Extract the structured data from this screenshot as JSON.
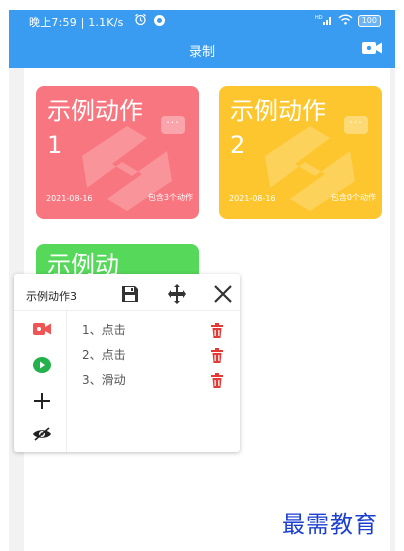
{
  "status_bar": {
    "time": "晚上7:59 | 1.1K/s",
    "battery": "100"
  },
  "header": {
    "title": "录制"
  },
  "cards": [
    {
      "name": "示例动作1",
      "date": "2021-08-16",
      "count": "包含3个动作",
      "color": "#f8767f",
      "more": "···"
    },
    {
      "name": "示例动作2",
      "date": "2021-08-16",
      "count": "包含0个动作",
      "color": "#fdc62e",
      "more": "···"
    },
    {
      "name": "示例动",
      "color": "#56d85a"
    }
  ],
  "panel": {
    "title": "示例动作3",
    "steps": [
      {
        "label": "1、点击"
      },
      {
        "label": "2、点击"
      },
      {
        "label": "3、滑动"
      }
    ]
  },
  "watermark": "最需教育",
  "colors": {
    "app_bar": "#3a9cf1",
    "danger": "#e53935",
    "play": "#22b14c",
    "record": "#f05454"
  }
}
